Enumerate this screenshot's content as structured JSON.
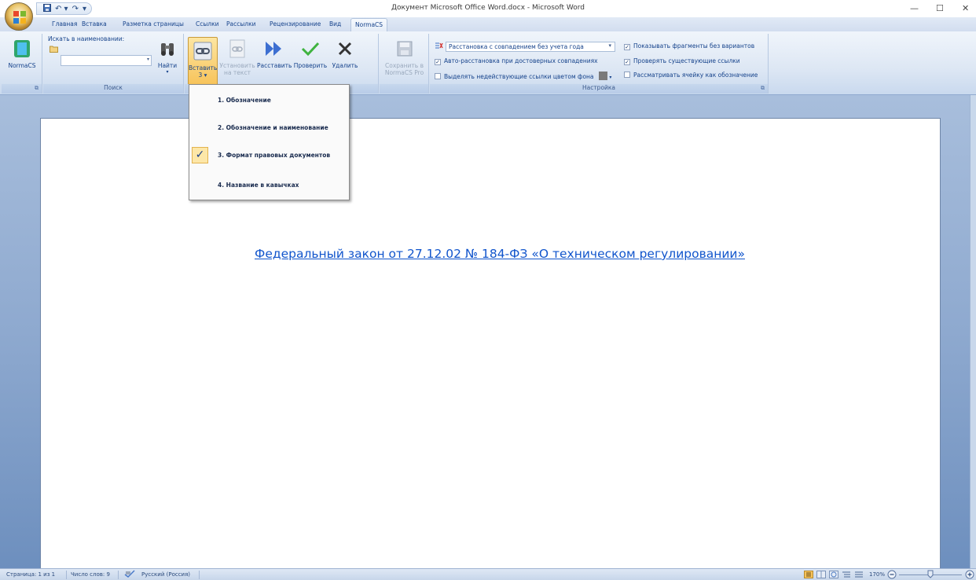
{
  "window": {
    "title": "Документ Microsoft Office Word.docx - Microsoft Word",
    "controls": {
      "minimize": "—",
      "maximize": "☐",
      "close": "✕"
    }
  },
  "qat": {
    "save_icon": "save-icon",
    "undo": "↶ ▾",
    "redo": "↷",
    "customize": "▾"
  },
  "tabs": [
    "Главная",
    "Вставка",
    "Разметка страницы",
    "Ссылки",
    "Рассылки",
    "Рецензирование",
    "Вид",
    "NormaCS"
  ],
  "active_tab": "NormaCS",
  "ribbon": {
    "normacs_btn": "NormaCS",
    "search": {
      "label": "Искать в наименовании:",
      "find_label": "Найти",
      "group_label": "Поиск"
    },
    "insert": {
      "label": "Вставить",
      "sub": "3  ▾"
    },
    "set_text": {
      "label1": "Установить",
      "label2": "на текст"
    },
    "arrange": {
      "label": "Расставить"
    },
    "check": {
      "label": "Проверить"
    },
    "delete": {
      "label": "Удалить"
    },
    "save_pro": {
      "label1": "Сохранить в",
      "label2": "NormaCS Pro"
    },
    "settings": {
      "combo_value": "Расстановка с совпадением без учета года",
      "auto_arrange": "Авто-расстановка при достоверных совпадениях",
      "highlight_invalid": "Выделять недействующие ссылки цветом фона",
      "show_fragments": "Показывать фрагменты без вариантов",
      "check_existing": "Проверять существующие ссылки",
      "cell_as_designation": "Рассматривать ячейку как обозначение",
      "group_label": "Настройка",
      "auto_arrange_checked": true,
      "highlight_invalid_checked": false,
      "show_fragments_checked": true,
      "check_existing_checked": true,
      "cell_as_designation_checked": false
    }
  },
  "menu": {
    "items": [
      {
        "label": "1. Обозначение",
        "checked": false
      },
      {
        "label": "2. Обозначение и наименование",
        "checked": false
      },
      {
        "label": "3. Формат правовых документов",
        "checked": true
      },
      {
        "label": "4. Название в кавычках",
        "checked": false
      }
    ],
    "check_mark": "✓"
  },
  "document": {
    "link_text": "Федеральный закон от 27.12.02 № 184-ФЗ «О техническом регулировании»"
  },
  "status": {
    "page": "Страница: 1 из 1",
    "words": "Число слов: 9",
    "language": "Русский (Россия)",
    "zoom": "170%"
  }
}
